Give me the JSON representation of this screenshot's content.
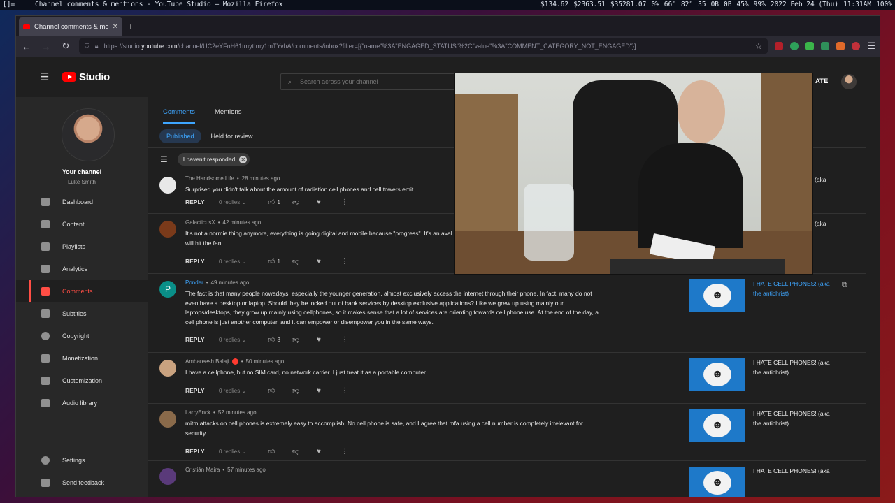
{
  "system_bar": {
    "workspace": "[]=",
    "window_title": "Channel comments & mentions - YouTube Studio — Mozilla Firefox",
    "tray": [
      "$134.62",
      "$2363.51",
      "$35281.07",
      "0%",
      "66°",
      "82°",
      "35",
      "0B",
      "0B",
      "45%",
      "99%",
      "2022 Feb 24 (Thu)",
      "11:31AM",
      "100%"
    ]
  },
  "browser": {
    "tab_title": "Channel comments & mentio",
    "url_prefix": "https://studio.",
    "url_host": "youtube.com",
    "url_rest": "/channel/UC2eYFnH61tmytImy1mTYvhA/comments/inbox?filter=[{\"name\"%3A\"ENGAGED_STATUS\"%2C\"value\"%3A\"COMMENT_CATEGORY_NOT_ENGAGED\"}]"
  },
  "header": {
    "logo_text": "Studio",
    "search_placeholder": "Search across your channel",
    "create_label": "ATE"
  },
  "sidebar": {
    "your_channel": "Your channel",
    "channel_name": "Luke Smith",
    "items": [
      {
        "label": "Dashboard"
      },
      {
        "label": "Content"
      },
      {
        "label": "Playlists"
      },
      {
        "label": "Analytics"
      },
      {
        "label": "Comments"
      },
      {
        "label": "Subtitles"
      },
      {
        "label": "Copyright"
      },
      {
        "label": "Monetization"
      },
      {
        "label": "Customization"
      },
      {
        "label": "Audio library"
      }
    ],
    "bottom": [
      {
        "label": "Settings"
      },
      {
        "label": "Send feedback"
      }
    ]
  },
  "main": {
    "tabs": [
      "Comments",
      "Mentions"
    ],
    "pills": [
      "Published",
      "Held for review"
    ],
    "filter_chip": "I haven't responded",
    "reply_label": "REPLY",
    "comments": [
      {
        "author": "The Handsome Life",
        "time": "28 minutes ago",
        "text": "Surprised you didn't talk about the amount of radiation cell phones and cell towers emit.",
        "replies": "0 replies",
        "likes": "1",
        "video_title": "(aka"
      },
      {
        "author": "GalacticusX",
        "time": "42 minutes ago",
        "text": "It's not a normie thing anymore, everything is going digital and mobile because \"progress\". It's an aval bank digital currency, that's gonna really be when the sht will hit the fan.",
        "replies": "0 replies",
        "likes": "1",
        "video_title": "(aka"
      },
      {
        "author": "Ponder",
        "time": "49 minutes ago",
        "text": "The fact is that many people nowadays, especially the younger generation, almost exclusively access the internet through their phone. In fact, many do not even have a desktop or laptop. Should they be locked out of bank services by desktop exclusive applications? Like we grew up using mainly our laptops/desktops, they grow up mainly using cellphones, so it makes sense that a lot of services are orienting towards cell phone use. At the end of the day, a cell phone is just another computer, and it can empower or disempower you in the same ways.",
        "replies": "0 replies",
        "likes": "3",
        "video_title": "I HATE CELL PHONES! (aka the antichrist)"
      },
      {
        "author": "Ambareesh Balaji",
        "time": "50 minutes ago",
        "text": "I have a cellphone, but no SIM card, no network carrier. I just treat it as a portable computer.",
        "replies": "0 replies",
        "likes": "",
        "video_title": "I HATE CELL PHONES! (aka the antichrist)"
      },
      {
        "author": "LarryEnck",
        "time": "52 minutes ago",
        "text": "mitm attacks on cell phones is extremely easy to accomplish. No cell phone is safe, and I agree that mfa using a cell number is completely irrelevant for security.",
        "replies": "0 replies",
        "likes": "",
        "video_title": "I HATE CELL PHONES! (aka the antichrist)"
      },
      {
        "author": "Cristián Maira",
        "time": "57 minutes ago",
        "text": "",
        "replies": "",
        "likes": "",
        "video_title": "I HATE CELL PHONES! (aka"
      }
    ]
  },
  "colors": {
    "accent_blue": "#3ea6ff",
    "active_red": "#ff4e45",
    "studio_bg": "#1f1f1f",
    "sidebar_bg": "#282828"
  }
}
